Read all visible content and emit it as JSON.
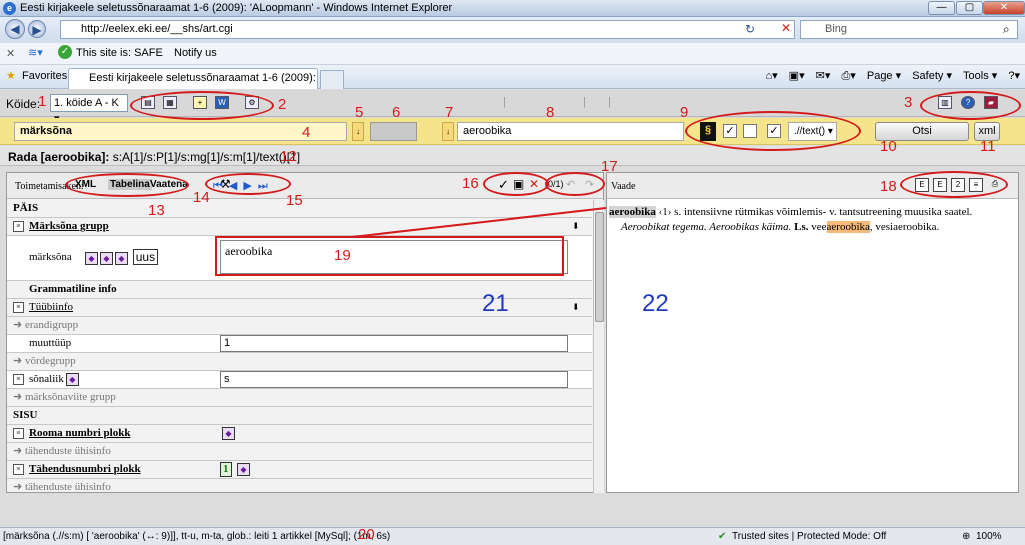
{
  "window": {
    "title": "Eesti kirjakeele seletussõnaraamat 1-6 (2009): 'ALoopmann' - Windows Internet Explorer",
    "min": "—",
    "max": "▢",
    "close": "✕"
  },
  "browser": {
    "url": "http://eelex.eki.ee/__shs/art.cgi",
    "search_placeholder": "Bing",
    "site_safe": "This site is: SAFE",
    "notify": "Notify us",
    "favorites": "Favorites",
    "tab_title": "Eesti kirjakeele seletussõnaraamat 1-6 (2009): 'AL...",
    "cmd": [
      "Page ▾",
      "Safety ▾",
      "Tools ▾"
    ]
  },
  "apptool": {
    "koide_label": "Köide:",
    "koide_value": "1. köide A - K"
  },
  "search": {
    "field_name": "märksõna",
    "value": "aeroobika",
    "xpath": ".//text()",
    "search_button": "Otsi",
    "xml_button": "xml"
  },
  "path": {
    "label": "Rada [aeroobika]:",
    "value": "s:A[1]/s:P[1]/s:mg[1]/s:m[1]/text()[1]"
  },
  "editor": {
    "mode_label": "Toimetamisaken:",
    "modes": [
      "XML",
      "Tabelina",
      "Vaatena"
    ],
    "counter": "(0/1)",
    "rows": {
      "pais": "PÄIS",
      "marksona_grupp": "Märksõna grupp",
      "marksona": "märksõna",
      "uus": "uus",
      "marksona_value": "aeroobika",
      "grammatiline": "Grammatiline info",
      "tyybiinfo": "Tüübiinfo",
      "erandigrupp": "erandigrupp",
      "muuttyyp": "muuttüüp",
      "muuttyyp_value": "1",
      "vordegrupp": "võrdegrupp",
      "sonaliik": "sõnaliik",
      "sonaliik_value": "s",
      "marksonaviite": "märksõnaviite grupp",
      "sisu": "SISU",
      "rooma": "Rooma numbri plokk",
      "tahenduste_yhis": "tähenduste ühisinfo",
      "tahendusnumbri": "Tähendusnumbri plokk",
      "tahendusnumbri_value": "1",
      "tahenduste_yhis2": "tähenduste ühisinfo"
    }
  },
  "viewer": {
    "label": "Vaade",
    "headword": "aeroobika",
    "entry_rest": " ‹1› s. intensiivne rütmikas võimlemis- v. tantsutreening muusika saatel.",
    "examples": "Aeroobikat tegema. Aeroobikas käima.",
    "ls_label": "Ls.",
    "ls_prefix": " vee",
    "ls_highlight": "aeroobika",
    "ls_suffix": ", vesiaeroobika."
  },
  "status": {
    "left": "[märksõna (.//s:m) [ 'aeroobika' (↔: 9)]], tt-u, m-ta, glob.: leiti 1 artikkel [MySql]; (1m, 6s)",
    "zone": "Trusted sites | Protected Mode: Off",
    "zoom": "100%"
  },
  "annotations": {
    "n1": "1",
    "n2": "2",
    "n3": "3",
    "n4": "4",
    "n5": "5",
    "n6": "6",
    "n7": "7",
    "n8": "8",
    "n9": "9",
    "n10": "10",
    "n11": "11",
    "n12": "12",
    "n13": "13",
    "n14": "14",
    "n15": "15",
    "n16": "16",
    "n17": "17",
    "n18": "18",
    "n19": "19",
    "n20": "20",
    "n21": "21",
    "n22": "22"
  },
  "colors": {
    "annotation_red": "#d41b1b",
    "annotation_blue": "#1d3bbf",
    "search_bg": "#f4e48c",
    "highlight": "#f7b977"
  }
}
